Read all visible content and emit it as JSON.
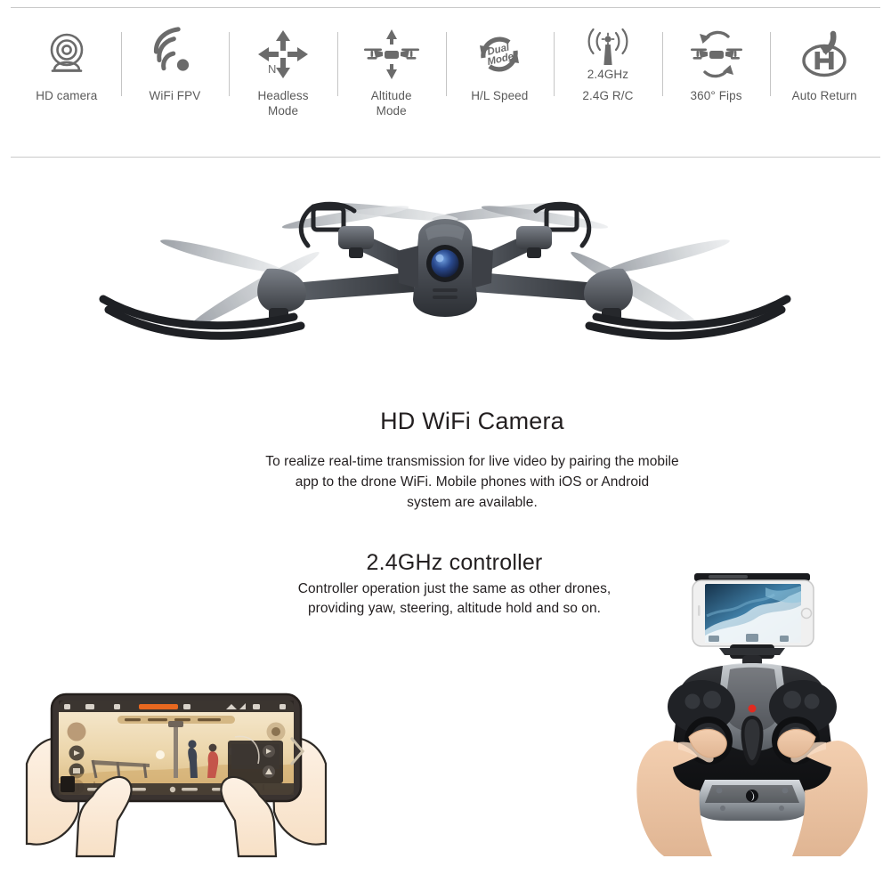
{
  "page": {
    "background": "#ffffff",
    "text_color": "#231f20",
    "label_color": "#5a5a5a",
    "divider_color": "#c9c9c9"
  },
  "features": [
    {
      "label": "HD camera",
      "icon": "hd-camera-icon",
      "subtext": ""
    },
    {
      "label": "WiFi FPV",
      "icon": "wifi-signal-icon",
      "subtext": ""
    },
    {
      "label": "Headless\nMode",
      "icon": "four-way-arrow-icon",
      "subtext": "",
      "badge": "N"
    },
    {
      "label": "Altitude\nMode",
      "icon": "altitude-drone-icon",
      "subtext": ""
    },
    {
      "label": "H/L Speed",
      "icon": "dual-mode-loop-icon",
      "subtext": "",
      "badge": "Dual Mode"
    },
    {
      "label": "2.4G R/C",
      "icon": "antenna-signal-icon",
      "subtext": "2.4GHz"
    },
    {
      "label": "360° Fips",
      "icon": "flip-rotation-icon",
      "subtext": ""
    },
    {
      "label": "Auto Return",
      "icon": "helipad-return-icon",
      "subtext": ""
    }
  ],
  "sections": {
    "camera": {
      "heading": "HD WiFi Camera",
      "lines": [
        "To realize real-time transmission for live video by pairing the mobile",
        "app to the drone WiFi. Mobile phones with iOS or Android",
        "system are available."
      ]
    },
    "controller": {
      "heading": "2.4GHz controller",
      "lines": [
        "Controller operation just the same as other drones,",
        "providing yaw, steering, altitude hold and so on."
      ]
    }
  },
  "images": {
    "drone": "foldable-quadcopter-drone-photo",
    "phone_hands": "hands-holding-phone-fpv-app-illustration",
    "controller_hands": "hands-holding-rc-controller-with-phone-photo"
  },
  "colors": {
    "drone_body": "#4a4d52",
    "drone_dark": "#2b2d31",
    "camera_lens": "#2a4a8f",
    "app_accent": "#e8681f",
    "app_warm": "#e8d3a8",
    "controller_black": "#1c1c1e",
    "controller_silver": "#9aa0a6",
    "phone_white": "#f2f2f2",
    "screen_blue": "#3d6f96",
    "skin": "#f6d9bd"
  }
}
